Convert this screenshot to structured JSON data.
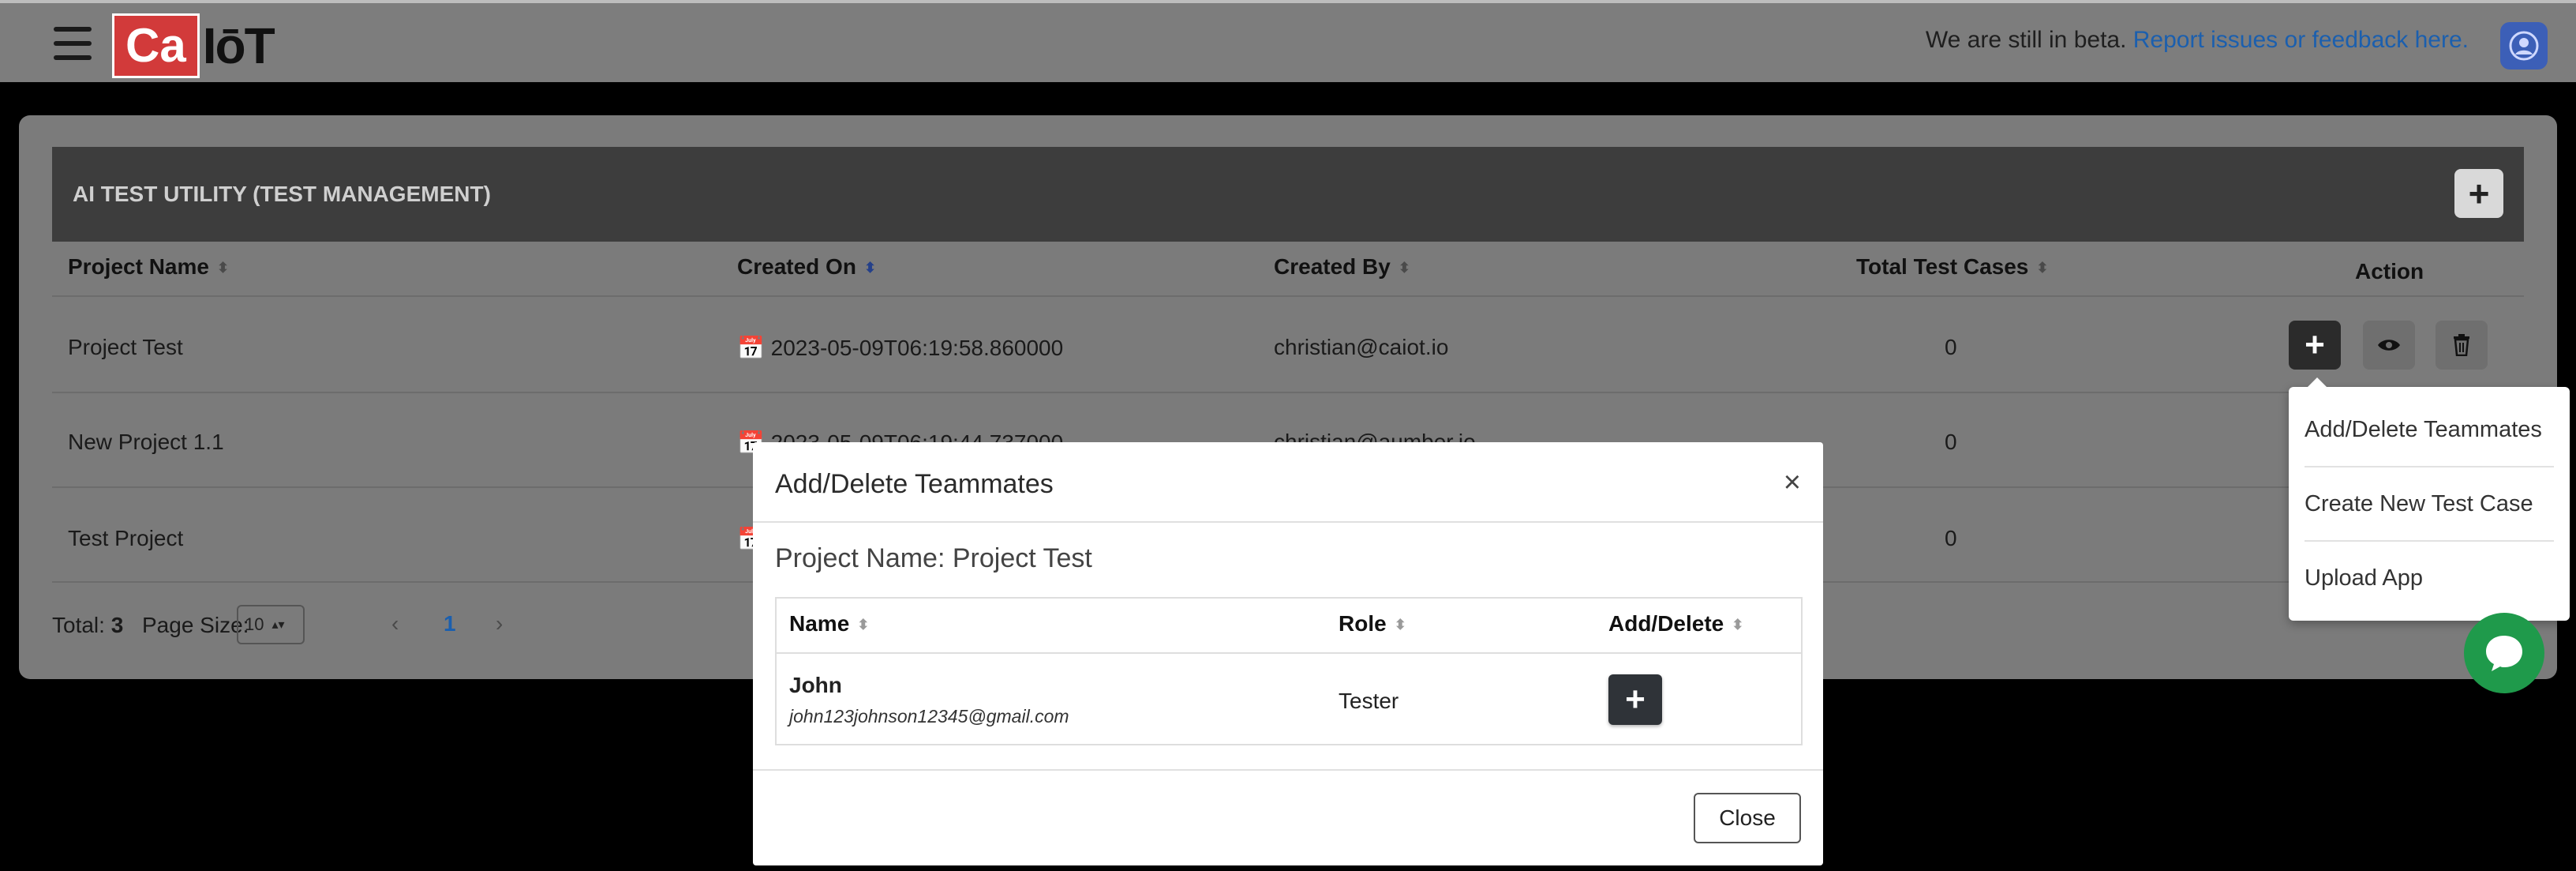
{
  "header": {
    "logo_left": "Ca",
    "logo_right": "IōT",
    "beta_text": "We are still in beta.",
    "beta_link": "Report issues or feedback here."
  },
  "card": {
    "title": "AI TEST UTILITY (TEST MANAGEMENT)",
    "add_label": "+",
    "columns": [
      "Project Name",
      "Created On",
      "Created By",
      "Total Test Cases",
      "Action"
    ],
    "rows": [
      {
        "name": "Project Test",
        "created_on": "2023-05-09T06:19:58.860000",
        "created_by": "christian@caiot.io",
        "total": "0"
      },
      {
        "name": "New Project 1.1",
        "created_on": "2023-05-09T06:19:44.737000",
        "created_by": "christian@aumber.io",
        "total": "0"
      },
      {
        "name": "Test Project",
        "created_on": "",
        "created_by": "",
        "total": "0"
      }
    ],
    "footer": {
      "total_label": "Total:",
      "total_value": "3",
      "page_size_label": "Page Size:",
      "page_size_value": "10",
      "prev": "‹",
      "current_page": "1",
      "next": "›"
    }
  },
  "dropdown": {
    "items": [
      "Add/Delete Teammates",
      "Create New Test Case",
      "Upload App"
    ]
  },
  "modal": {
    "title": "Add/Delete Teammates",
    "close_x": "×",
    "project_name": "Project Name: Project Test",
    "columns": [
      "Name",
      "Role",
      "Add/Delete"
    ],
    "teammates": [
      {
        "name": "John",
        "email": "john123johnson12345@gmail.com",
        "role": "Tester",
        "action": "+"
      }
    ],
    "close_button": "Close"
  },
  "colors": {
    "header_bg": "#7d7d7d",
    "link": "#1b5fae",
    "avatar": "#3c5fb7",
    "chat": "#1f9a4b",
    "logo_red": "#d23a3a"
  }
}
